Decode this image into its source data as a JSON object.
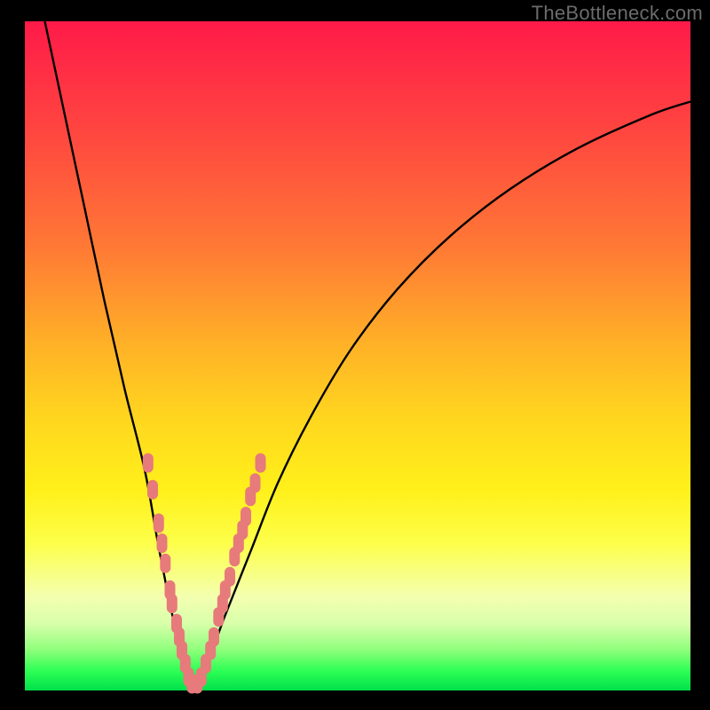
{
  "watermark": "TheBottleneck.com",
  "chart_data": {
    "type": "line",
    "title": "",
    "xlabel": "",
    "ylabel": "",
    "xlim": [
      0,
      100
    ],
    "ylim": [
      0,
      100
    ],
    "grid": false,
    "background_gradient_stops": [
      {
        "pos": 0,
        "color": "#ff1a49"
      },
      {
        "pos": 18,
        "color": "#ff4a3f"
      },
      {
        "pos": 34,
        "color": "#ff7a35"
      },
      {
        "pos": 48,
        "color": "#ffb027"
      },
      {
        "pos": 60,
        "color": "#ffd81e"
      },
      {
        "pos": 70,
        "color": "#fff01a"
      },
      {
        "pos": 78,
        "color": "#fdff4a"
      },
      {
        "pos": 86,
        "color": "#f4ffb0"
      },
      {
        "pos": 90,
        "color": "#d8ffab"
      },
      {
        "pos": 94,
        "color": "#8dff7a"
      },
      {
        "pos": 97,
        "color": "#2fff55"
      },
      {
        "pos": 100,
        "color": "#00e04a"
      }
    ],
    "series": [
      {
        "name": "bottleneck-curve",
        "color": "#000000",
        "x": [
          3,
          6,
          9,
          12,
          15,
          18,
          20,
          22,
          24,
          25,
          27,
          30,
          34,
          38,
          43,
          49,
          56,
          64,
          73,
          83,
          94,
          100
        ],
        "y": [
          100,
          86,
          72,
          58,
          45,
          33,
          22,
          12,
          3,
          0,
          3,
          11,
          21,
          31,
          41,
          51,
          60,
          68,
          75,
          81,
          86,
          88
        ]
      }
    ],
    "markers": {
      "name": "data-points",
      "color": "#e77a7a",
      "shape": "rounded-pill",
      "points": [
        {
          "x": 18.5,
          "y": 34
        },
        {
          "x": 19.2,
          "y": 30
        },
        {
          "x": 20.1,
          "y": 25
        },
        {
          "x": 20.6,
          "y": 22
        },
        {
          "x": 21.1,
          "y": 19
        },
        {
          "x": 21.8,
          "y": 15
        },
        {
          "x": 22.1,
          "y": 13
        },
        {
          "x": 22.8,
          "y": 10
        },
        {
          "x": 23.2,
          "y": 8
        },
        {
          "x": 23.6,
          "y": 6
        },
        {
          "x": 24.1,
          "y": 4
        },
        {
          "x": 24.6,
          "y": 2
        },
        {
          "x": 25.1,
          "y": 1
        },
        {
          "x": 25.9,
          "y": 1
        },
        {
          "x": 26.5,
          "y": 2
        },
        {
          "x": 27.2,
          "y": 4
        },
        {
          "x": 27.9,
          "y": 6
        },
        {
          "x": 28.4,
          "y": 8
        },
        {
          "x": 29.1,
          "y": 11
        },
        {
          "x": 29.7,
          "y": 13
        },
        {
          "x": 30.1,
          "y": 15
        },
        {
          "x": 30.8,
          "y": 17
        },
        {
          "x": 31.5,
          "y": 20
        },
        {
          "x": 32.1,
          "y": 22
        },
        {
          "x": 32.7,
          "y": 24
        },
        {
          "x": 33.2,
          "y": 26
        },
        {
          "x": 33.9,
          "y": 29
        },
        {
          "x": 34.6,
          "y": 31
        },
        {
          "x": 35.4,
          "y": 34
        }
      ]
    },
    "note": "Values are approximate, read from a 0–100 coordinate system overlaid on the plot area. The curve dips to y≈0 near x≈25 (the bottleneck optimum) and rises on both sides. Salmon pill markers cluster along both sides of the V near the bottom."
  }
}
